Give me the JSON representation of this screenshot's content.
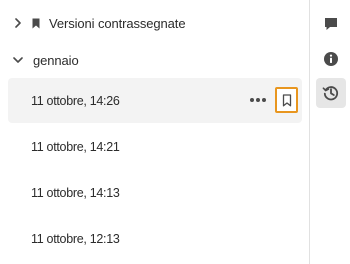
{
  "versions_panel": {
    "marked_group": {
      "label": "Versioni contrassegnate",
      "expanded": false
    },
    "month_group": {
      "label": "gennaio",
      "expanded": true
    },
    "versions": [
      {
        "time": "11 ottobre, 14:26",
        "selected": true
      },
      {
        "time": "11 ottobre, 14:21",
        "selected": false
      },
      {
        "time": "11 ottobre, 14:13",
        "selected": false
      },
      {
        "time": "11 ottobre, 12:13",
        "selected": false
      }
    ]
  },
  "right_rail": {
    "items": [
      {
        "icon": "comment-icon",
        "active": false
      },
      {
        "icon": "info-icon",
        "active": false
      },
      {
        "icon": "history-icon",
        "active": true
      }
    ]
  },
  "colors": {
    "highlight_border": "#e8961f",
    "selected_row": "#f3f3f3",
    "active_rail": "#e6e6e6",
    "text": "#2c2c2c"
  }
}
